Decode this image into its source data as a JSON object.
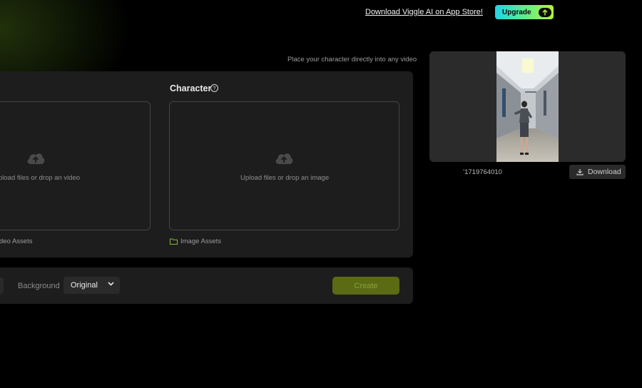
{
  "header": {
    "app_store_link": "Download Viggle AI on App Store!",
    "upgrade_label": "Upgrade"
  },
  "tagline": "Place your character directly into any video",
  "video_panel": {
    "upload_text": "pload files or drop an video",
    "assets_label": "deo Assets"
  },
  "character_panel": {
    "title": "Character",
    "help_symbol": "?",
    "upload_text": "Upload files or drop an image",
    "assets_label": "Image Assets"
  },
  "options": {
    "background_label": "Background",
    "background_value": "Original",
    "create_label": "Create"
  },
  "result": {
    "file_name": "’1719764010",
    "download_label": "Download"
  },
  "colors": {
    "accent_gradient_start": "#1fd3e8",
    "accent_gradient_end": "#b6f23a",
    "create_disabled": "#5a6b14",
    "folder_icon": "#7fb83a",
    "panel_bg": "#1d1d1d",
    "page_bg": "#000000"
  },
  "icons": [
    "upload-cloud-icon",
    "help-circle-icon",
    "folder-icon",
    "chevron-down-icon",
    "download-icon",
    "arrow-up-icon"
  ]
}
